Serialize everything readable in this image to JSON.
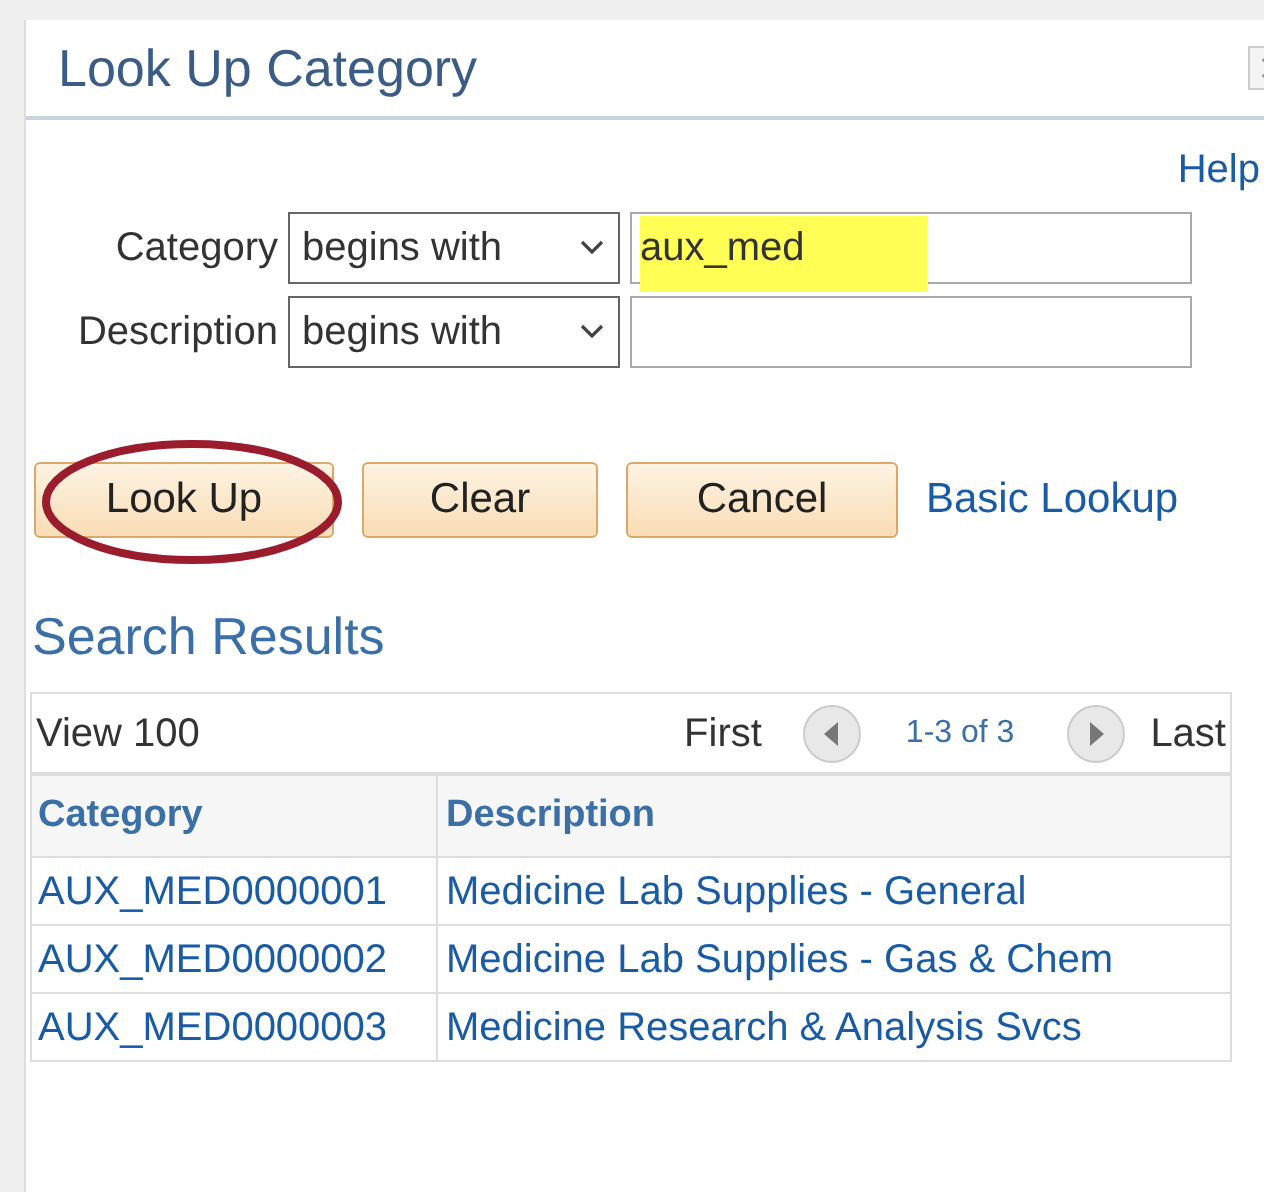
{
  "dialog": {
    "title": "Look Up Category"
  },
  "help_link": "Help",
  "criteria": [
    {
      "label": "Category",
      "operator": "begins with",
      "value": "aux_med",
      "highlighted": true
    },
    {
      "label": "Description",
      "operator": "begins with",
      "highlighted": false
    }
  ],
  "buttons": [
    {
      "label": "Look Up",
      "circled": true
    },
    {
      "label": "Clear",
      "circled": false
    },
    {
      "label": "Cancel",
      "circled": false
    }
  ],
  "basic_lookup_link": "Basic Lookup",
  "results": {
    "title": "Search Results",
    "view_all": "View 100",
    "first": "First",
    "range": "1-3 of 3",
    "last": "Last",
    "columns": [
      "Category",
      "Description"
    ],
    "rows": [
      [
        "AUX_MED0000001",
        "Medicine Lab Supplies - General"
      ],
      [
        "AUX_MED0000002",
        "Medicine Lab Supplies - Gas & Chem"
      ],
      [
        "AUX_MED0000003",
        "Medicine Research & Analysis Svcs"
      ]
    ]
  }
}
